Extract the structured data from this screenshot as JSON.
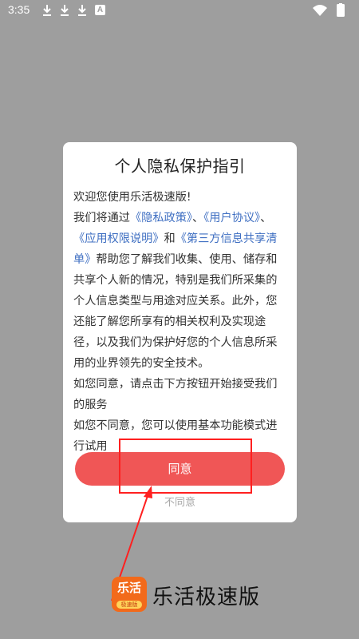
{
  "status_bar": {
    "time": "3:35",
    "notification_icons": [
      "download-icon",
      "download-icon",
      "download-icon",
      "a-app-icon"
    ],
    "a_icon_letter": "A",
    "right_icons": [
      "wifi-icon",
      "battery-icon"
    ]
  },
  "dialog": {
    "title": "个人隐私保护指引",
    "welcome": "欢迎您使用乐活极速版!",
    "intro_prefix": "我们将通过",
    "link_privacy": "《隐私政策》",
    "sep1": "、",
    "link_user": "《用户协议》",
    "sep2": "、",
    "link_permissions": "《应用权限说明》",
    "and": "和",
    "link_third_party": "《第三方信息共享清单》",
    "intro_suffix": "帮助您了解我们收集、使用、储存和共享个人新的情况，特别是我们所采集的个人信息类型与用途对应关系。此外，您还能了解您所享有的相关权利及实现途径，以及我们为保护好您的个人信息所采用的业界领先的安全技术。",
    "agree_hint": "如您同意，请点击下方按钮开始接受我们的服务",
    "disagree_hint": "如您不同意，您可以使用基本功能模式进行试用",
    "agree_button": "同意",
    "disagree_button": "不同意"
  },
  "brand": {
    "logo_text_top": "乐活",
    "logo_text_bottom": "极速版",
    "name": "乐活极速版"
  },
  "colors": {
    "overlay_background": "#9e9e9e",
    "agree_button": "#f05656",
    "link": "#3f6fc2",
    "annotation": "#ff2020",
    "logo_orange": "#f26a1b"
  }
}
